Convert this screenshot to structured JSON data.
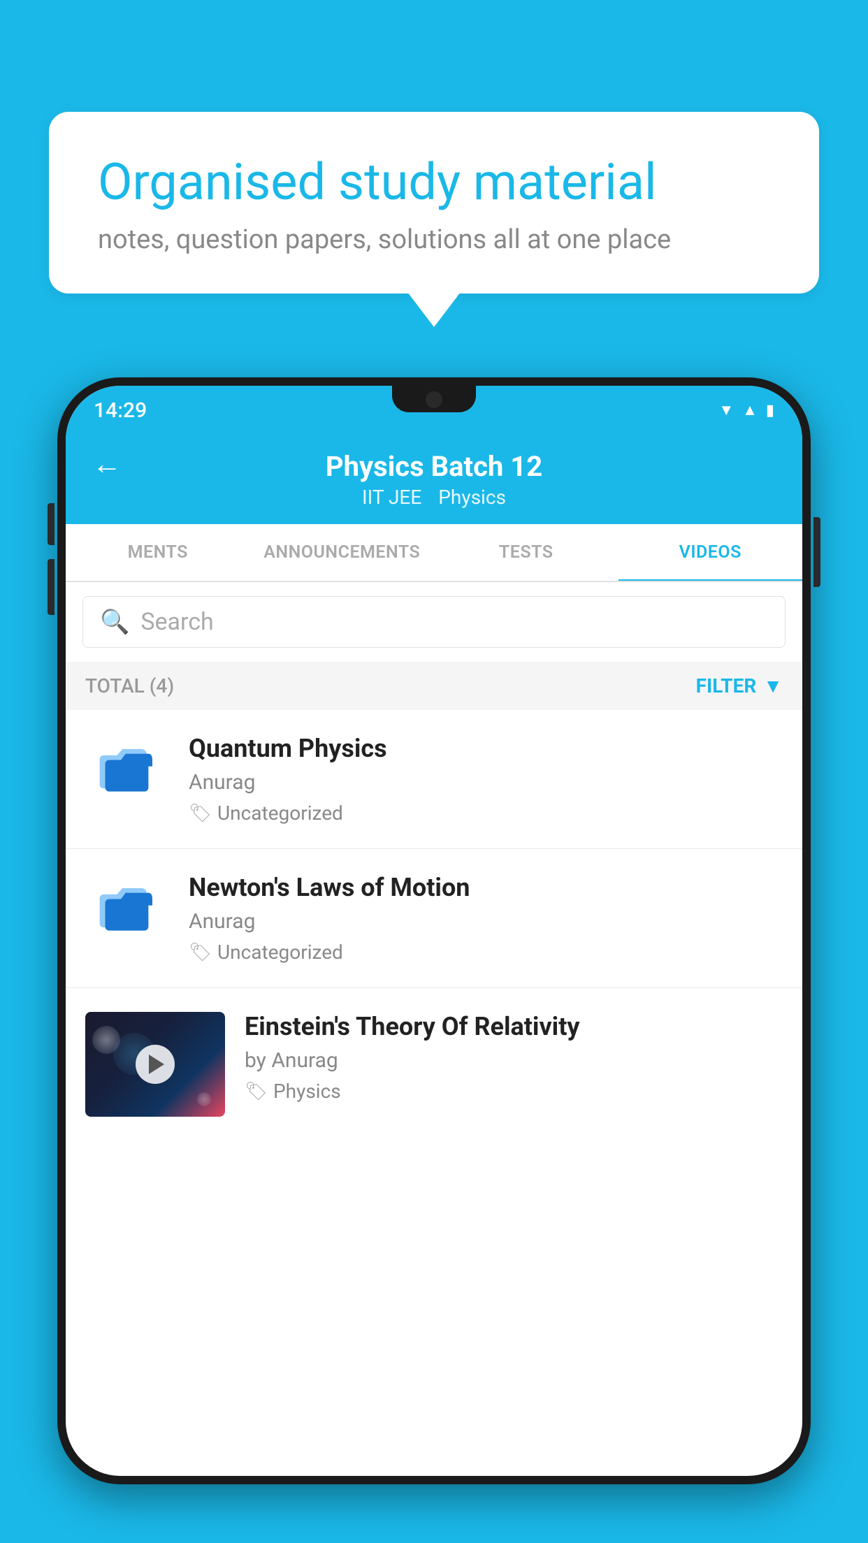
{
  "background_color": "#1ab8e8",
  "speech_bubble": {
    "title": "Organised study material",
    "subtitle": "notes, question papers, solutions all at one place"
  },
  "status_bar": {
    "time": "14:29",
    "wifi": "▾",
    "signal": "▴",
    "battery": "▮"
  },
  "app_bar": {
    "title": "Physics Batch 12",
    "subtitle1": "IIT JEE",
    "subtitle2": "Physics",
    "back_label": "←"
  },
  "tabs": [
    {
      "label": "MENTS",
      "active": false
    },
    {
      "label": "ANNOUNCEMENTS",
      "active": false
    },
    {
      "label": "TESTS",
      "active": false
    },
    {
      "label": "VIDEOS",
      "active": true
    }
  ],
  "search": {
    "placeholder": "Search"
  },
  "filter_row": {
    "total": "TOTAL (4)",
    "filter_label": "FILTER"
  },
  "videos": [
    {
      "id": "quantum",
      "title": "Quantum Physics",
      "author": "Anurag",
      "tag": "Uncategorized",
      "has_thumb": false
    },
    {
      "id": "newton",
      "title": "Newton's Laws of Motion",
      "author": "Anurag",
      "tag": "Uncategorized",
      "has_thumb": false
    },
    {
      "id": "einstein",
      "title": "Einstein's Theory Of Relativity",
      "author": "by Anurag",
      "tag": "Physics",
      "has_thumb": true
    }
  ]
}
